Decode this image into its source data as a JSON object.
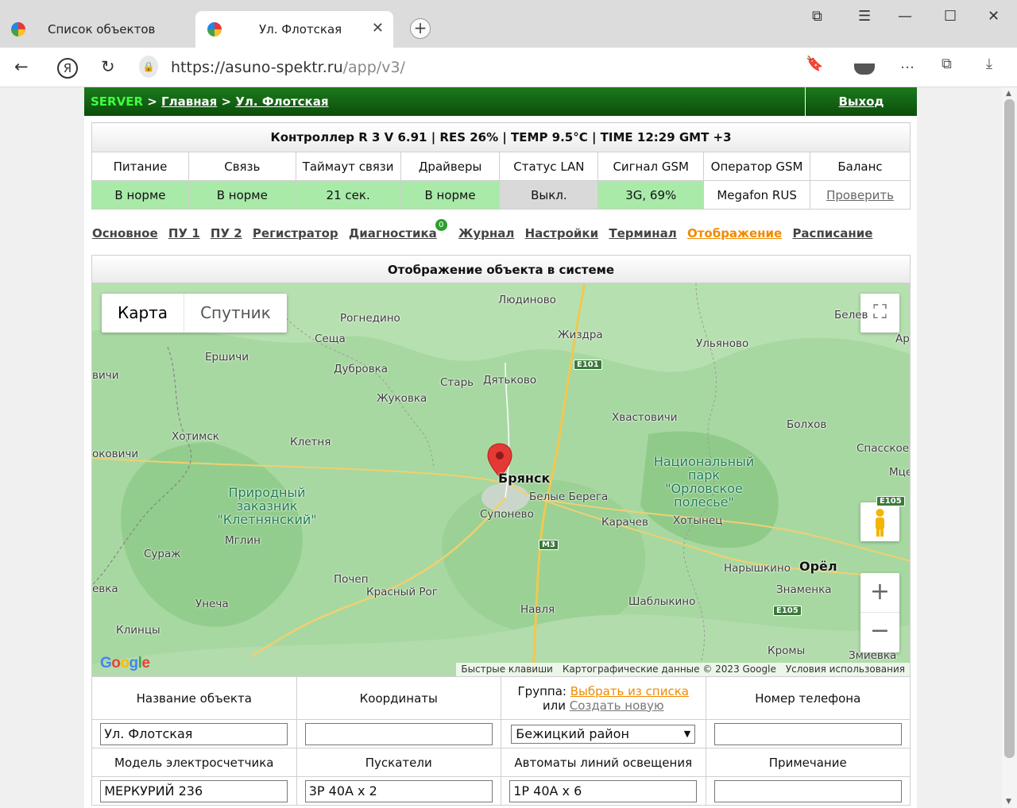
{
  "browser": {
    "tabs": [
      {
        "title": "Список объектов"
      },
      {
        "title": "Ул. Флотская"
      }
    ],
    "url_domain": "https://asuno-spektr.ru",
    "url_path": "/app/v3/"
  },
  "topbar": {
    "server": "SERVER",
    "sep1": " > ",
    "home": "Главная",
    "sep2": " > ",
    "object": "Ул. Флотская",
    "exit": "Выход"
  },
  "status": {
    "title": "Контроллер R 3 V 6.91 | RES 26% | TEMP 9.5°C | TIME 12:29 GMT +3",
    "headers": [
      "Питание",
      "Связь",
      "Таймаут связи",
      "Драйверы",
      "Статус LAN",
      "Сигнал GSM",
      "Оператор GSM",
      "Баланс"
    ],
    "values": [
      "В норме",
      "В норме",
      "21 сек.",
      "В норме",
      "Выкл.",
      "3G, 69%",
      "Megafon RUS",
      "Проверить"
    ]
  },
  "menu": {
    "items": [
      "Основное",
      "ПУ 1",
      "ПУ 2",
      "Регистратор",
      "Диагностика",
      "Журнал",
      "Настройки",
      "Терминал",
      "Отображение",
      "Расписание"
    ],
    "badge": "0",
    "colors": {
      "active": "#f08a00"
    }
  },
  "map_section": {
    "title": "Отображение объекта в системе",
    "map_type_map": "Карта",
    "map_type_satellite": "Спутник",
    "places": {
      "lyudinovo": "Людиново",
      "rognedino": "Рогнедино",
      "seshcha": "Сеща",
      "zhizdra": "Жиздра",
      "belev": "Белев",
      "ar": "Ар",
      "ulyanovo": "Ульяново",
      "ershichi": "Ершичи",
      "dubrovka": "Дубровка",
      "star": "Старь",
      "dyatkovo": "Дятьково",
      "vichi": "вичи",
      "zhukovka": "Жуковка",
      "khvastovichi": "Хвастовичи",
      "bolkhov": "Болхов",
      "khotimsk": "Хотимск",
      "kletnya": "Клетня",
      "spasskoe": "Спасское",
      "kovichi": "оковичи",
      "bryansk": "Брянск",
      "mtse": "Мце",
      "park": "Национальный парк \"Орловское полесье\"",
      "reserve": "Природный заказник \"Клетнянский\"",
      "belye_berega": "Белые Берега",
      "suponevo": "Супонево",
      "karachev": "Карачев",
      "khotynets": "Хотынец",
      "mglin": "Мглин",
      "surazh": "Сураж",
      "narishkino": "Нарышкино",
      "orel": "Орёл",
      "pochep": "Почеп",
      "krasny_rog": "Красный Рог",
      "evka": "евка",
      "znamenka": "Знаменка",
      "unecha": "Унеча",
      "navlya": "Навля",
      "shablykino": "Шаблыкино",
      "klintsy": "Клинцы",
      "kromy": "Кромы",
      "zmievka": "Змиевка"
    },
    "shields": {
      "e101": "E101",
      "m3": "M3",
      "e105": "E105",
      "e105b": "E105"
    },
    "attribution": {
      "shortcuts": "Быстрые клавиши",
      "data": "Картографические данные © 2023 Google",
      "terms": "Условия использования"
    },
    "logo": "Google"
  },
  "form": {
    "labels_row1": {
      "name": "Название объекта",
      "coords": "Координаты",
      "group_prefix": "Группа: ",
      "group_pick": "Выбрать из списка",
      "group_or": "или ",
      "group_new": "Создать новую",
      "phone": "Номер телефона"
    },
    "values_row1": {
      "name": "Ул. Флотская",
      "coords": "",
      "group": "Бежицкий район",
      "phone": ""
    },
    "labels_row2": {
      "meter": "Модель электросчетчика",
      "starters": "Пускатели",
      "breakers": "Автоматы линий освещения",
      "note": "Примечание"
    },
    "values_row2": {
      "meter": "МЕРКУРИЙ 236",
      "starters": "3Р 40А х 2",
      "breakers": "1Р 40А х 6",
      "note": ""
    }
  }
}
